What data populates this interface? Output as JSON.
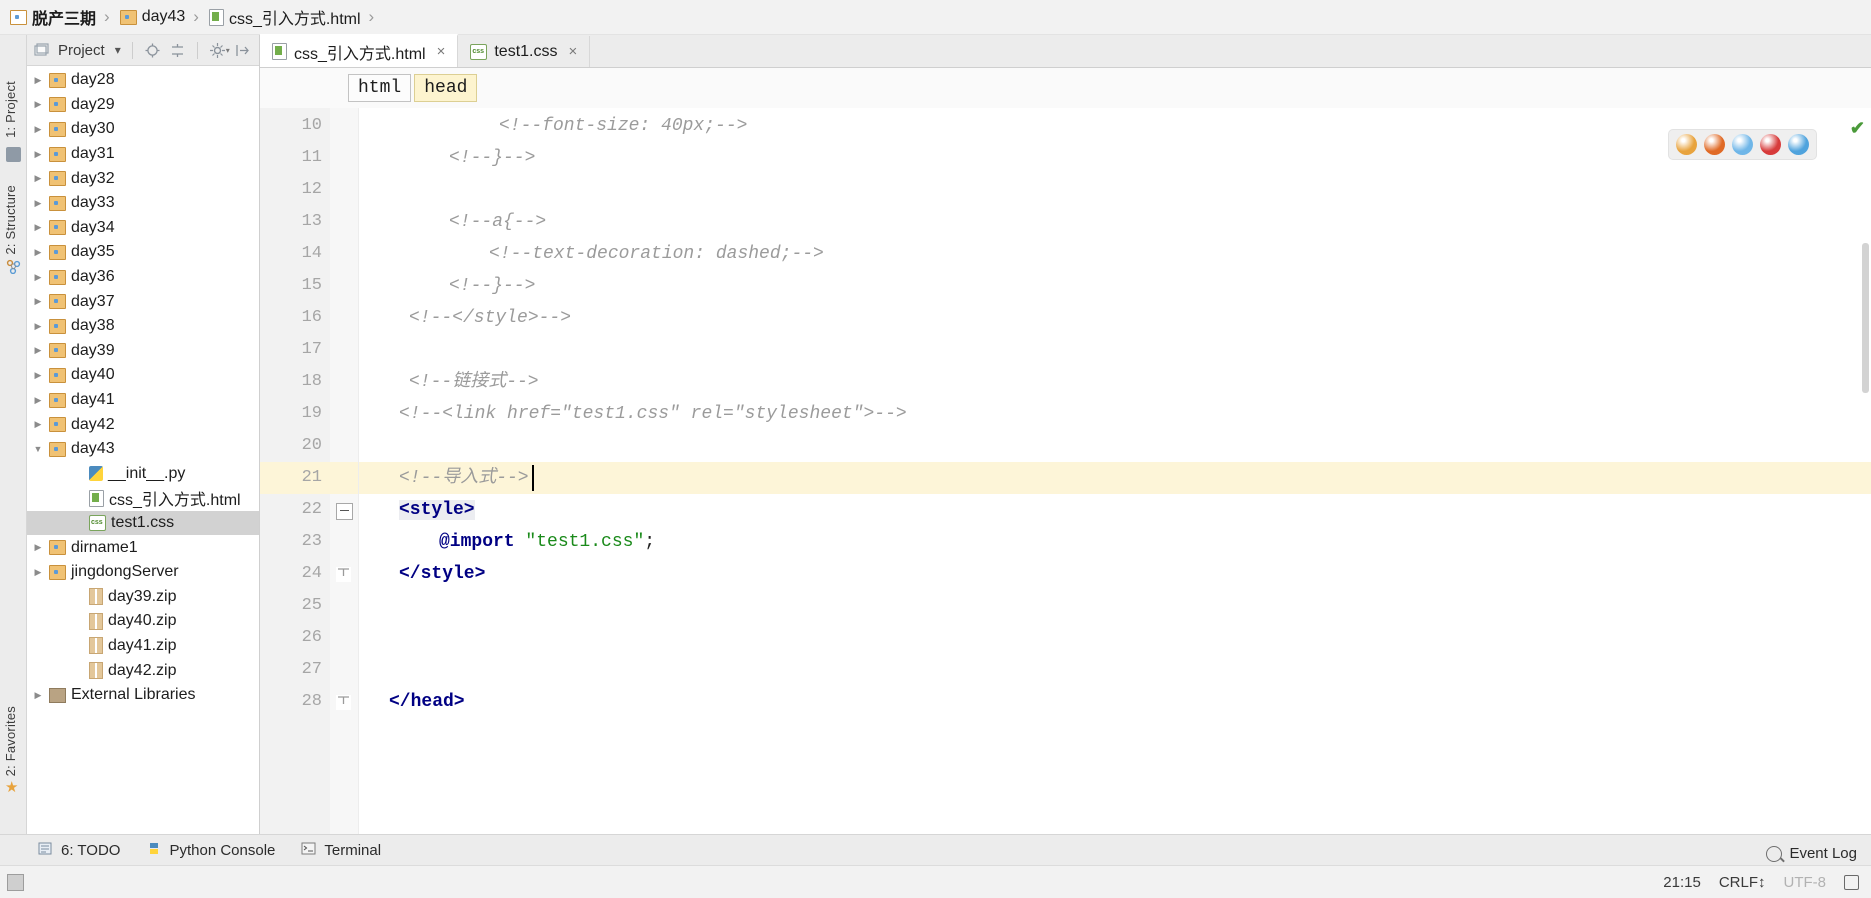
{
  "breadcrumb": {
    "items": [
      {
        "label": "脱产三期",
        "icon": "folder-icon"
      },
      {
        "label": "day43",
        "icon": "folder-icon"
      },
      {
        "label": "css_引入方式.html",
        "icon": "html-file-icon"
      }
    ],
    "separator": "›"
  },
  "left_strip": {
    "project_tab": "1: Project",
    "structure_tab": "2: Structure",
    "favorites_tab": "2: Favorites"
  },
  "project_panel": {
    "title": "Project",
    "dropdown_caret": "▾",
    "toolbar_icons": [
      "locate-icon",
      "collapse-all-icon",
      "settings-icon",
      "hide-icon"
    ],
    "tree": [
      {
        "label": "day28",
        "type": "folder",
        "expanded": false,
        "indent": 0,
        "selected": false
      },
      {
        "label": "day29",
        "type": "folder",
        "expanded": false,
        "indent": 0,
        "selected": false
      },
      {
        "label": "day30",
        "type": "folder",
        "expanded": false,
        "indent": 0,
        "selected": false
      },
      {
        "label": "day31",
        "type": "folder",
        "expanded": false,
        "indent": 0,
        "selected": false
      },
      {
        "label": "day32",
        "type": "folder",
        "expanded": false,
        "indent": 0,
        "selected": false
      },
      {
        "label": "day33",
        "type": "folder",
        "expanded": false,
        "indent": 0,
        "selected": false
      },
      {
        "label": "day34",
        "type": "folder",
        "expanded": false,
        "indent": 0,
        "selected": false
      },
      {
        "label": "day35",
        "type": "folder",
        "expanded": false,
        "indent": 0,
        "selected": false
      },
      {
        "label": "day36",
        "type": "folder",
        "expanded": false,
        "indent": 0,
        "selected": false
      },
      {
        "label": "day37",
        "type": "folder",
        "expanded": false,
        "indent": 0,
        "selected": false
      },
      {
        "label": "day38",
        "type": "folder",
        "expanded": false,
        "indent": 0,
        "selected": false
      },
      {
        "label": "day39",
        "type": "folder",
        "expanded": false,
        "indent": 0,
        "selected": false
      },
      {
        "label": "day40",
        "type": "folder",
        "expanded": false,
        "indent": 0,
        "selected": false
      },
      {
        "label": "day41",
        "type": "folder",
        "expanded": false,
        "indent": 0,
        "selected": false
      },
      {
        "label": "day42",
        "type": "folder",
        "expanded": false,
        "indent": 0,
        "selected": false
      },
      {
        "label": "day43",
        "type": "folder",
        "expanded": true,
        "indent": 0,
        "selected": false
      },
      {
        "label": "__init__.py",
        "type": "python",
        "expanded": null,
        "indent": 1,
        "selected": false
      },
      {
        "label": "css_引入方式.html",
        "type": "html",
        "expanded": null,
        "indent": 1,
        "selected": false
      },
      {
        "label": "test1.css",
        "type": "css",
        "expanded": null,
        "indent": 1,
        "selected": true
      },
      {
        "label": "dirname1",
        "type": "folder",
        "expanded": false,
        "indent": 0,
        "selected": false
      },
      {
        "label": "jingdongServer",
        "type": "folder",
        "expanded": false,
        "indent": 0,
        "selected": false
      },
      {
        "label": "day39.zip",
        "type": "zip",
        "expanded": null,
        "indent": 1,
        "selected": false
      },
      {
        "label": "day40.zip",
        "type": "zip",
        "expanded": null,
        "indent": 1,
        "selected": false
      },
      {
        "label": "day41.zip",
        "type": "zip",
        "expanded": null,
        "indent": 1,
        "selected": false
      },
      {
        "label": "day42.zip",
        "type": "zip",
        "expanded": null,
        "indent": 1,
        "selected": false
      },
      {
        "label": "External Libraries",
        "type": "library",
        "expanded": false,
        "indent": 0,
        "selected": false
      }
    ]
  },
  "editor": {
    "tabs": [
      {
        "label": "css_引入方式.html",
        "icon": "html-file-icon",
        "active": true,
        "close": "×"
      },
      {
        "label": "test1.css",
        "icon": "css-file-icon",
        "active": false,
        "close": "×"
      }
    ],
    "structure_breadcrumb": [
      {
        "label": "html",
        "highlighted": false
      },
      {
        "label": "head",
        "highlighted": true
      }
    ],
    "inspection_ok_icon": "✔",
    "browsers": [
      {
        "name": "chrome-icon",
        "color": "#e8a33d"
      },
      {
        "name": "firefox-icon",
        "color": "#e06a26"
      },
      {
        "name": "safari-icon",
        "color": "#6fb6e8"
      },
      {
        "name": "opera-icon",
        "color": "#d73b3b"
      },
      {
        "name": "ie-icon",
        "color": "#4fa3dd"
      }
    ],
    "first_line_number": 10,
    "highlighted_line": 21,
    "caret_line": 21,
    "lines": [
      {
        "num": 10,
        "indent": 14,
        "segments": [
          {
            "t": "<!--font-size: 40px;-->",
            "c": "cmt"
          }
        ]
      },
      {
        "num": 11,
        "indent": 9,
        "segments": [
          {
            "t": "<!--}-->",
            "c": "cmt"
          }
        ]
      },
      {
        "num": 12,
        "indent": 0,
        "segments": []
      },
      {
        "num": 13,
        "indent": 9,
        "segments": [
          {
            "t": "<!--a{-->",
            "c": "cmt"
          }
        ]
      },
      {
        "num": 14,
        "indent": 13,
        "segments": [
          {
            "t": "<!--text-decoration: dashed;-->",
            "c": "cmt"
          }
        ]
      },
      {
        "num": 15,
        "indent": 9,
        "segments": [
          {
            "t": "<!--}-->",
            "c": "cmt"
          }
        ]
      },
      {
        "num": 16,
        "indent": 5,
        "segments": [
          {
            "t": "<!--</style>-->",
            "c": "cmt"
          }
        ]
      },
      {
        "num": 17,
        "indent": 0,
        "segments": []
      },
      {
        "num": 18,
        "indent": 5,
        "segments": [
          {
            "t": "<!--链接式-->",
            "c": "cmt"
          }
        ]
      },
      {
        "num": 19,
        "indent": 4,
        "segments": [
          {
            "t": "<!--<link href=\"test1.css\" rel=\"stylesheet\">-->",
            "c": "cmt"
          }
        ]
      },
      {
        "num": 20,
        "indent": 0,
        "segments": []
      },
      {
        "num": 21,
        "indent": 4,
        "segments": [
          {
            "t": "<!--导入式-->",
            "c": "cmt"
          }
        ]
      },
      {
        "num": 22,
        "indent": 4,
        "segments": [
          {
            "t": "<style>",
            "c": "tag tagbg"
          }
        ]
      },
      {
        "num": 23,
        "indent": 8,
        "segments": [
          {
            "t": "@import ",
            "c": "kw"
          },
          {
            "t": "\"test1.css\"",
            "c": "str"
          },
          {
            "t": ";",
            "c": "punct"
          }
        ]
      },
      {
        "num": 24,
        "indent": 4,
        "segments": [
          {
            "t": "</style>",
            "c": "tag"
          }
        ]
      },
      {
        "num": 25,
        "indent": 0,
        "segments": []
      },
      {
        "num": 26,
        "indent": 0,
        "segments": []
      },
      {
        "num": 27,
        "indent": 0,
        "segments": []
      },
      {
        "num": 28,
        "indent": 3,
        "segments": [
          {
            "t": "</head>",
            "c": "tag"
          }
        ]
      }
    ]
  },
  "tool_windows": [
    {
      "label": "6: TODO",
      "prefix": "6",
      "icon": "todo-icon"
    },
    {
      "label": "Python Console",
      "icon": "python-icon"
    },
    {
      "label": "Terminal",
      "icon": "terminal-icon"
    }
  ],
  "event_log": {
    "label": "Event Log",
    "icon": "event-log-icon"
  },
  "status_bar": {
    "time": "21:15",
    "line_separator": "CRLF↕",
    "encoding": "UTF-8",
    "lock_icon": "lock-open-icon"
  },
  "colors": {
    "accent_highlight": "#fdf5d8",
    "selection": "#d2d2d2",
    "keyword": "#000083",
    "string": "#1a8a1a",
    "comment": "#9b9b9b"
  }
}
